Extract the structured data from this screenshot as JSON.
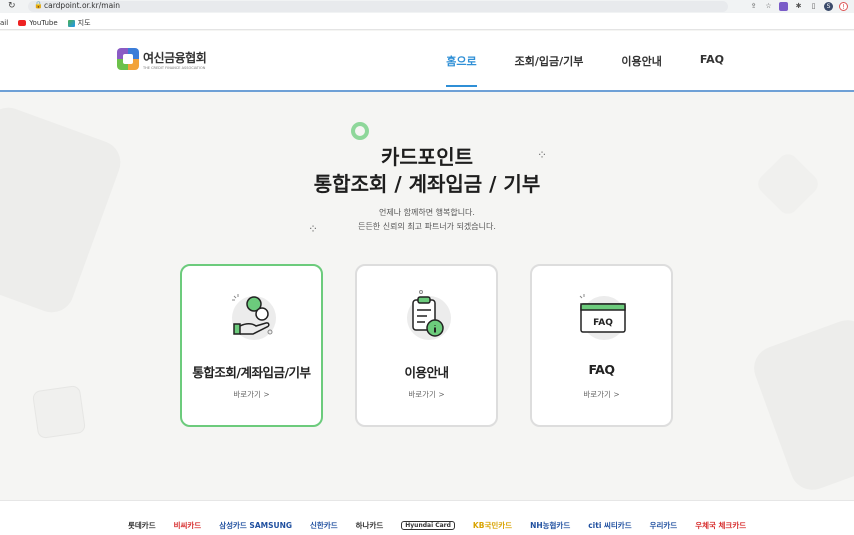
{
  "browser": {
    "url": "cardpoint.or.kr/main",
    "bookmarks": [
      "ail",
      "YouTube",
      "지도"
    ],
    "profile_initial": "S"
  },
  "header": {
    "logo_text": "여신금융협회",
    "logo_subtext": "THE CREDIT FINANCE ASSOCIATION",
    "nav": [
      "홈으로",
      "조회/입금/기부",
      "이용안내",
      "FAQ"
    ],
    "active_nav": "홈으로"
  },
  "hero": {
    "title_line1": "카드포인트",
    "title_line2": "통합조회 / 계좌입금 / 기부",
    "subtitle_line1": "언제나 함께하면 행복합니다.",
    "subtitle_line2": "든든한 신뢰의 최고 파트너가 되겠습니다."
  },
  "cards": [
    {
      "label": "통합조회/계좌입금/기부",
      "link": "바로가기 >",
      "icon": "hand-coin-icon",
      "active": true
    },
    {
      "label": "이용안내",
      "link": "바로가기 >",
      "icon": "clipboard-info-icon",
      "active": false
    },
    {
      "label": "FAQ",
      "link": "바로가기 >",
      "icon": "faq-window-icon",
      "active": false
    }
  ],
  "footer": {
    "partners": [
      "롯데카드",
      "비씨카드",
      "삼성카드 SAMSUNG",
      "신한카드",
      "하나카드",
      "Hyundai Card",
      "KB국민카드",
      "NH농협카드",
      "citi 씨티카드",
      "우리카드",
      "우체국 체크카드"
    ]
  },
  "colors": {
    "accent_blue": "#2f8fd6",
    "accent_green": "#6ccb7c"
  }
}
